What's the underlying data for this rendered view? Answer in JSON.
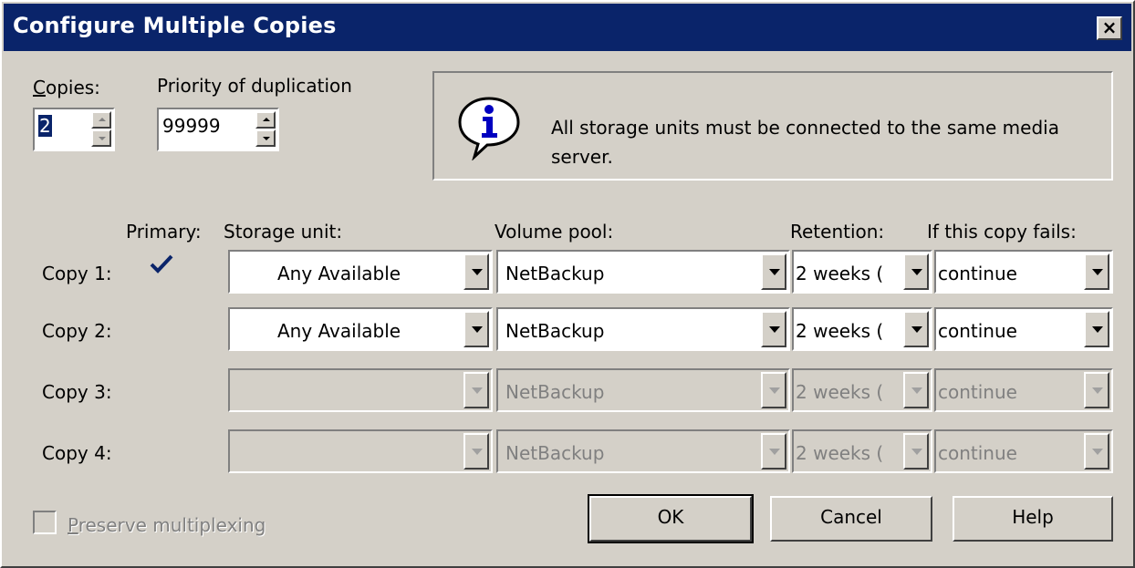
{
  "window": {
    "title": "Configure Multiple Copies",
    "close_glyph": "×"
  },
  "copies": {
    "label": "Copies:",
    "value": "2"
  },
  "priority": {
    "label": "Priority of duplication",
    "value": "99999"
  },
  "info": {
    "icon": "info-balloon-icon",
    "text": "All storage units must be connected to the same media server."
  },
  "columns": {
    "primary": "Primary:",
    "storage_unit": "Storage unit:",
    "volume_pool": "Volume pool:",
    "retention": "Retention:",
    "if_fails": "If this copy fails:"
  },
  "rows": [
    {
      "label": "Copy 1:",
      "primary": true,
      "storage_unit": "Any Available",
      "volume_pool": "NetBackup",
      "retention": "2 weeks (",
      "if_fails": "continue",
      "enabled": true
    },
    {
      "label": "Copy 2:",
      "primary": false,
      "storage_unit": "Any Available",
      "volume_pool": "NetBackup",
      "retention": "2 weeks (",
      "if_fails": "continue",
      "enabled": true
    },
    {
      "label": "Copy 3:",
      "primary": false,
      "storage_unit": "",
      "volume_pool": "NetBackup",
      "retention": "2 weeks (",
      "if_fails": "continue",
      "enabled": false
    },
    {
      "label": "Copy 4:",
      "primary": false,
      "storage_unit": "",
      "volume_pool": "NetBackup",
      "retention": "2 weeks (",
      "if_fails": "continue",
      "enabled": false
    }
  ],
  "preserve_multiplexing": {
    "label": "Preserve multiplexing",
    "checked": false,
    "enabled": false
  },
  "buttons": {
    "ok": "OK",
    "cancel": "Cancel",
    "help": "Help"
  },
  "colors": {
    "title_bar": "#0a246a",
    "face": "#d4d0c8",
    "check": "#0a246a"
  }
}
